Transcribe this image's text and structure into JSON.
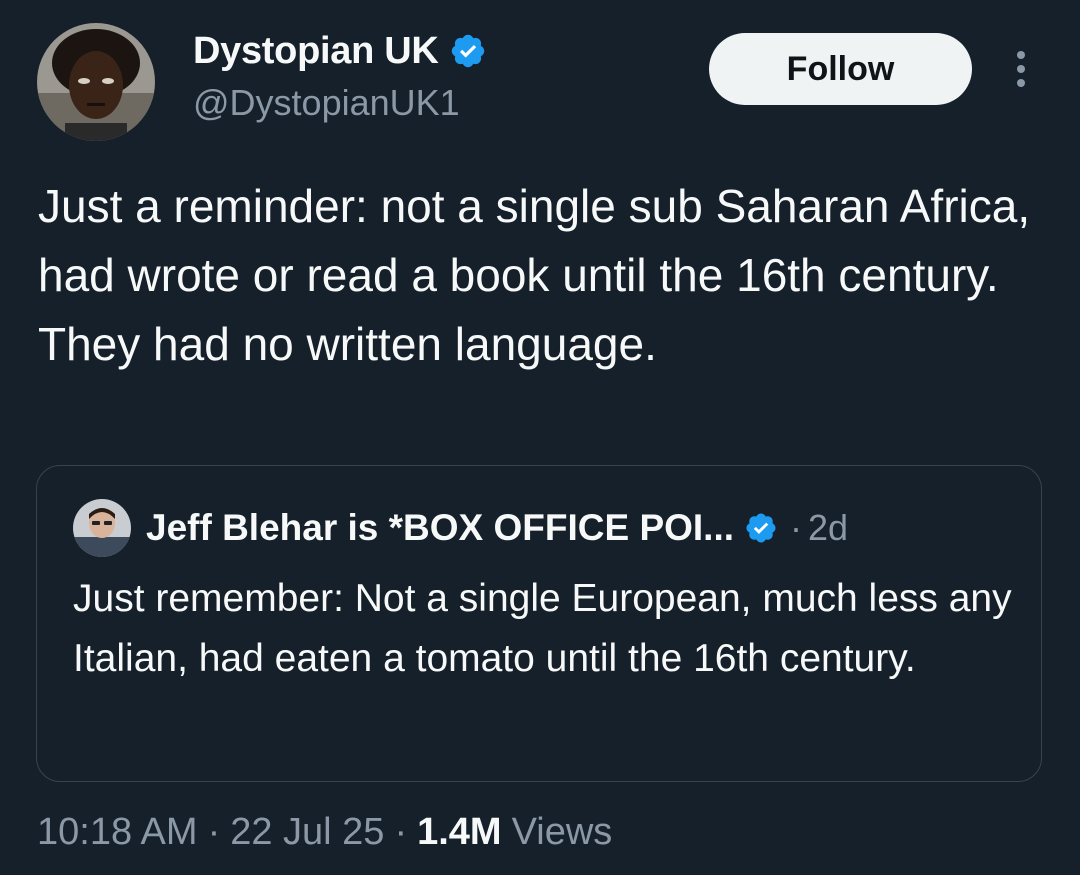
{
  "author": {
    "display_name": "Dystopian UK",
    "handle": "@DystopianUK1",
    "verified_icon": "verified-badge-icon",
    "avatar_icon": "profile-photo"
  },
  "header": {
    "follow_label": "Follow",
    "more_icon": "more-options-icon"
  },
  "tweet": {
    "text": "Just a reminder: not a single sub Saharan Africa, had wrote or read a book until the 16th century. They had no written language."
  },
  "quoted_tweet": {
    "display_name": "Jeff Blehar is *BOX OFFICE POI...",
    "verified_icon": "verified-badge-icon",
    "separator": "·",
    "time": "2d",
    "text": "Just remember: Not a single European, much less any Italian, had eaten a tomato until the 16th century."
  },
  "meta": {
    "time": "10:18 AM",
    "separator": "·",
    "date": "22 Jul 25",
    "views_count": "1.4M",
    "views_label": "Views"
  },
  "colors": {
    "background": "#15202b",
    "text_primary": "#f7f9f9",
    "text_secondary": "#8b98a5",
    "verified_blue": "#1d9bf0",
    "follow_bg": "#eff3f4",
    "border": "#38444d"
  }
}
